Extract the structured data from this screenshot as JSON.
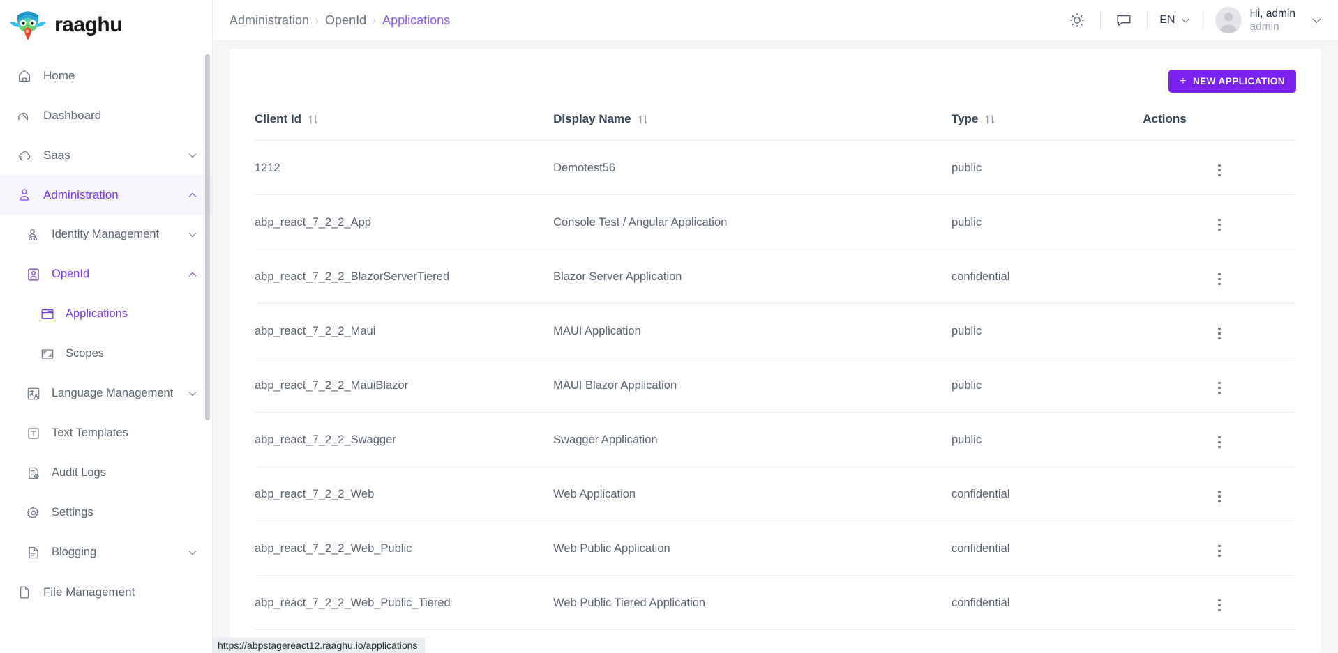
{
  "brand": {
    "name": "raaghu",
    "logo_icon": "raaghu-bird-logo"
  },
  "sidebar": {
    "items": [
      {
        "label": "Home",
        "icon": "home-icon",
        "level": 1,
        "active": false,
        "expandable": false
      },
      {
        "label": "Dashboard",
        "icon": "dashboard-speedometer-icon",
        "level": 1,
        "active": false,
        "expandable": false
      },
      {
        "label": "Saas",
        "icon": "cloud-icon",
        "level": 1,
        "active": false,
        "expandable": true,
        "expanded": false
      },
      {
        "label": "Administration",
        "icon": "user-admin-icon",
        "level": 1,
        "active": true,
        "expandable": true,
        "expanded": true
      },
      {
        "label": "Identity Management",
        "icon": "identity-users-icon",
        "level": 2,
        "active": false,
        "expandable": true,
        "expanded": false
      },
      {
        "label": "OpenId",
        "icon": "openid-badge-icon",
        "level": 2,
        "active": true,
        "expandable": true,
        "expanded": true
      },
      {
        "label": "Applications",
        "icon": "applications-window-icon",
        "level": 3,
        "active": true,
        "expandable": false
      },
      {
        "label": "Scopes",
        "icon": "scopes-frame-icon",
        "level": 3,
        "active": false,
        "expandable": false
      },
      {
        "label": "Language Management",
        "icon": "language-translate-icon",
        "level": 2,
        "active": false,
        "expandable": true,
        "expanded": false
      },
      {
        "label": "Text Templates",
        "icon": "text-template-icon",
        "level": 2,
        "active": false,
        "expandable": false
      },
      {
        "label": "Audit Logs",
        "icon": "audit-logs-icon",
        "level": 2,
        "active": false,
        "expandable": false
      },
      {
        "label": "Settings",
        "icon": "gear-icon",
        "level": 2,
        "active": false,
        "expandable": false
      },
      {
        "label": "Blogging",
        "icon": "document-icon",
        "level": 2,
        "active": false,
        "expandable": true,
        "expanded": false
      },
      {
        "label": "File Management",
        "icon": "file-icon",
        "level": 1,
        "active": false,
        "expandable": false
      }
    ]
  },
  "header": {
    "breadcrumb": [
      {
        "label": "Administration",
        "current": false
      },
      {
        "label": "OpenId",
        "current": false
      },
      {
        "label": "Applications",
        "current": true
      }
    ],
    "separator": "›",
    "theme_icon": "sun-brightness-icon",
    "chat_icon": "chat-bubble-icon",
    "language": {
      "code": "EN",
      "chevron": "chevron-down-icon"
    },
    "user": {
      "greeting": "Hi, admin",
      "username": "admin",
      "avatar_icon": "user-avatar-icon"
    }
  },
  "toolbar": {
    "new_application_label": "NEW APPLICATION",
    "plus_glyph": "+"
  },
  "table": {
    "columns": [
      {
        "label": "Client Id",
        "sortable": true
      },
      {
        "label": "Display Name",
        "sortable": true
      },
      {
        "label": "Type",
        "sortable": true
      },
      {
        "label": "Actions",
        "sortable": false
      }
    ],
    "sort_icon": "sort-updown-icon",
    "row_action_icon": "more-vertical-icon",
    "rows": [
      {
        "client_id": "1212",
        "display_name": "Demotest56",
        "type": "public"
      },
      {
        "client_id": "abp_react_7_2_2_App",
        "display_name": "Console Test / Angular Application",
        "type": "public"
      },
      {
        "client_id": "abp_react_7_2_2_BlazorServerTiered",
        "display_name": "Blazor Server Application",
        "type": "confidential"
      },
      {
        "client_id": "abp_react_7_2_2_Maui",
        "display_name": "MAUI Application",
        "type": "public"
      },
      {
        "client_id": "abp_react_7_2_2_MauiBlazor",
        "display_name": "MAUI Blazor Application",
        "type": "public"
      },
      {
        "client_id": "abp_react_7_2_2_Swagger",
        "display_name": "Swagger Application",
        "type": "public"
      },
      {
        "client_id": "abp_react_7_2_2_Web",
        "display_name": "Web Application",
        "type": "confidential"
      },
      {
        "client_id": "abp_react_7_2_2_Web_Public",
        "display_name": "Web Public Application",
        "type": "confidential"
      },
      {
        "client_id": "abp_react_7_2_2_Web_Public_Tiered",
        "display_name": "Web Public Tiered Application",
        "type": "confidential"
      }
    ]
  },
  "statusbar": {
    "url": "https://abpstagereact12.raaghu.io/applications"
  },
  "colors": {
    "accent_purple": "#7c22f0",
    "active_nav_purple": "#7c3aed",
    "active_nav_bg": "#f6f4fb",
    "page_bg": "#f5f5f8",
    "text_default": "#5a6472"
  }
}
